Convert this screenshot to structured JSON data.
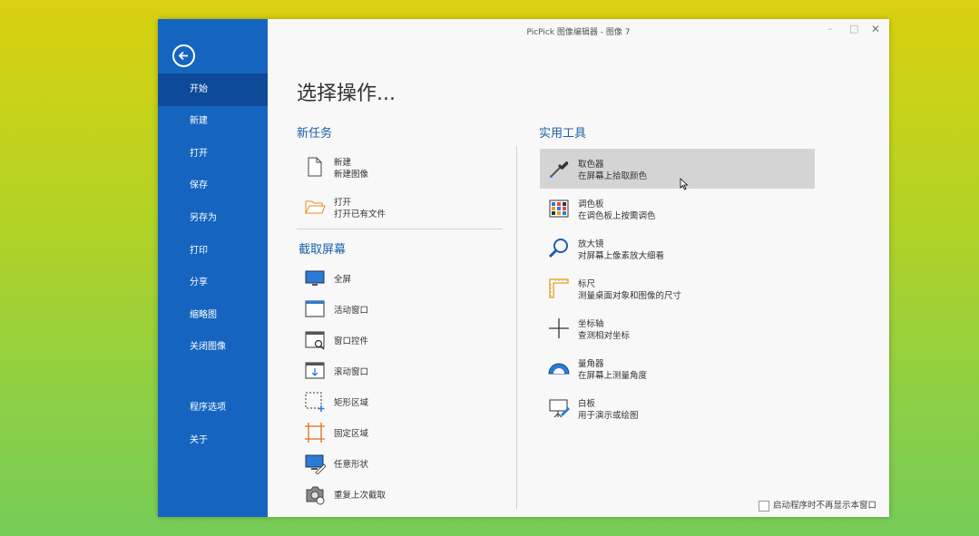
{
  "window": {
    "title": "PicPick 图像编辑器 - 图像 7",
    "min": "–",
    "max": "□",
    "close": "✕"
  },
  "sidebar": {
    "items": [
      {
        "label": "开始"
      },
      {
        "label": "新建"
      },
      {
        "label": "打开"
      },
      {
        "label": "保存"
      },
      {
        "label": "另存为"
      },
      {
        "label": "打印"
      },
      {
        "label": "分享"
      },
      {
        "label": "缩略图"
      },
      {
        "label": "关闭图像"
      },
      {
        "label": "程序选项"
      },
      {
        "label": "关于"
      }
    ]
  },
  "main": {
    "heading": "选择操作...",
    "new_task": {
      "title": "新任务",
      "items": [
        {
          "title": "新建",
          "desc": "新建图像",
          "icon": "new-file-icon"
        },
        {
          "title": "打开",
          "desc": "打开已有文件",
          "icon": "open-folder-icon"
        }
      ]
    },
    "capture": {
      "title": "截取屏幕",
      "items": [
        {
          "label": "全屏",
          "icon": "fullscreen-icon"
        },
        {
          "label": "活动窗口",
          "icon": "active-window-icon"
        },
        {
          "label": "窗口控件",
          "icon": "window-control-icon"
        },
        {
          "label": "滚动窗口",
          "icon": "scroll-window-icon"
        },
        {
          "label": "矩形区域",
          "icon": "rect-region-icon"
        },
        {
          "label": "固定区域",
          "icon": "fixed-region-icon"
        },
        {
          "label": "任意形状",
          "icon": "freehand-icon"
        },
        {
          "label": "重复上次截取",
          "icon": "repeat-capture-icon"
        }
      ]
    },
    "tools": {
      "title": "实用工具",
      "items": [
        {
          "title": "取色器",
          "desc": "在屏幕上拾取颜色",
          "icon": "color-picker-icon"
        },
        {
          "title": "调色板",
          "desc": "在调色板上按需调色",
          "icon": "palette-icon"
        },
        {
          "title": "放大镜",
          "desc": "对屏幕上像素放大细看",
          "icon": "magnifier-icon"
        },
        {
          "title": "标尺",
          "desc": "测量桌面对象和图像的尺寸",
          "icon": "ruler-icon"
        },
        {
          "title": "坐标轴",
          "desc": "查测相对坐标",
          "icon": "crosshair-icon"
        },
        {
          "title": "量角器",
          "desc": "在屏幕上测量角度",
          "icon": "protractor-icon"
        },
        {
          "title": "白板",
          "desc": "用于演示或绘图",
          "icon": "whiteboard-icon"
        }
      ]
    },
    "dont_show": "启动程序时不再显示本窗口"
  }
}
